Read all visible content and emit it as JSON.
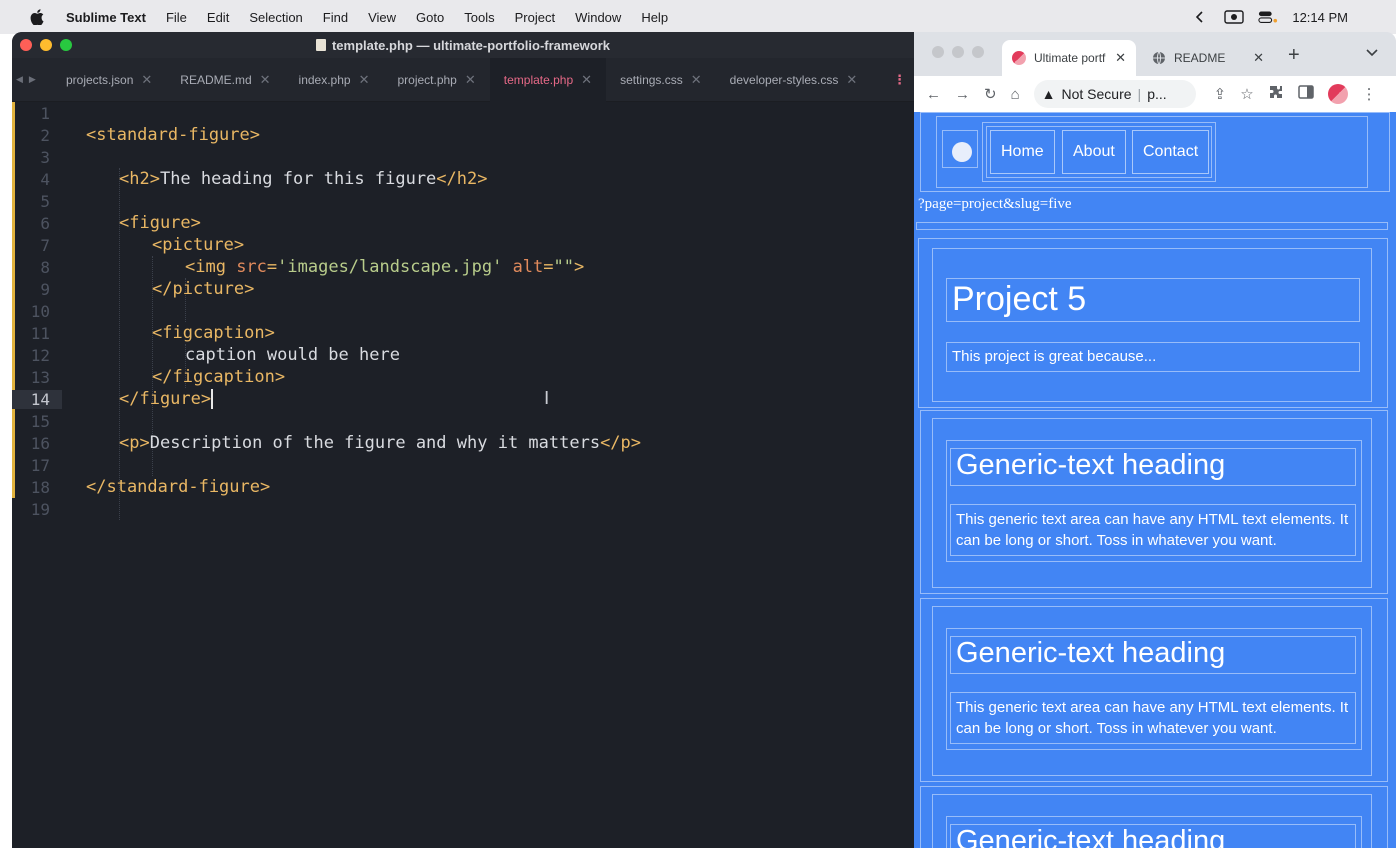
{
  "menubar": {
    "app_name": "Sublime Text",
    "items": [
      "File",
      "Edit",
      "Selection",
      "Find",
      "View",
      "Goto",
      "Tools",
      "Project",
      "Window",
      "Help"
    ],
    "clock": "12:14 PM"
  },
  "sublime": {
    "window_title": "template.php — ultimate-portfolio-framework",
    "tabs": [
      {
        "label": "projects.json",
        "active": false
      },
      {
        "label": "README.md",
        "active": false
      },
      {
        "label": "index.php",
        "active": false
      },
      {
        "label": "project.php",
        "active": false
      },
      {
        "label": "template.php",
        "active": true
      },
      {
        "label": "settings.css",
        "active": false
      },
      {
        "label": "developer-styles.css",
        "active": false
      }
    ],
    "current_line": 14,
    "lines": [
      {
        "n": "1"
      },
      {
        "n": "2",
        "t": "<standard-figure>"
      },
      {
        "n": "3"
      },
      {
        "n": "4",
        "t": "<h2>",
        "x": "The heading for this figure",
        "t2": "</h2>"
      },
      {
        "n": "5"
      },
      {
        "n": "6",
        "t": "<figure>"
      },
      {
        "n": "7",
        "t": "<picture>"
      },
      {
        "n": "8",
        "t": "<img ",
        "a": "src",
        "e": "=",
        "s": "'images/landscape.jpg'",
        "a2": " alt",
        "e2": "=",
        "s2": "\"\"",
        "t2": ">"
      },
      {
        "n": "9",
        "t": "</picture>"
      },
      {
        "n": "10"
      },
      {
        "n": "11",
        "t": "<figcaption>"
      },
      {
        "n": "12",
        "x": "caption would be here"
      },
      {
        "n": "13",
        "t": "</figcaption>"
      },
      {
        "n": "14",
        "t": "</figure>"
      },
      {
        "n": "15"
      },
      {
        "n": "16",
        "t": "<p>",
        "x": "Description of the figure and why it matters",
        "t2": "</p>"
      },
      {
        "n": "17"
      },
      {
        "n": "18",
        "t": "</standard-figure>"
      },
      {
        "n": "19"
      }
    ]
  },
  "browser": {
    "tabs": [
      {
        "label": "Ultimate portf",
        "active": true
      },
      {
        "label": "README",
        "active": false
      }
    ],
    "address": {
      "security": "Not Secure",
      "url": "p..."
    },
    "page": {
      "nav": [
        "Home",
        "About",
        "Contact"
      ],
      "query_text": "?page=project&slug=five",
      "project_title": "Project 5",
      "project_desc": "This project is great because...",
      "sections": [
        {
          "heading": "Generic-text heading",
          "body": "This generic text area can have any HTML text elements. It can be long or short. Toss in whatever you want."
        },
        {
          "heading": "Generic-text heading",
          "body": "This generic text area can have any HTML text elements. It can be long or short. Toss in whatever you want."
        },
        {
          "heading": "Generic-text heading"
        }
      ]
    }
  },
  "colors": {
    "editor_bg": "#1d2027",
    "tag": "#e9b764",
    "attr": "#e08a5c",
    "string": "#b8cc8b",
    "active_tab": "#e66987",
    "page_blue": "#4285f4"
  }
}
